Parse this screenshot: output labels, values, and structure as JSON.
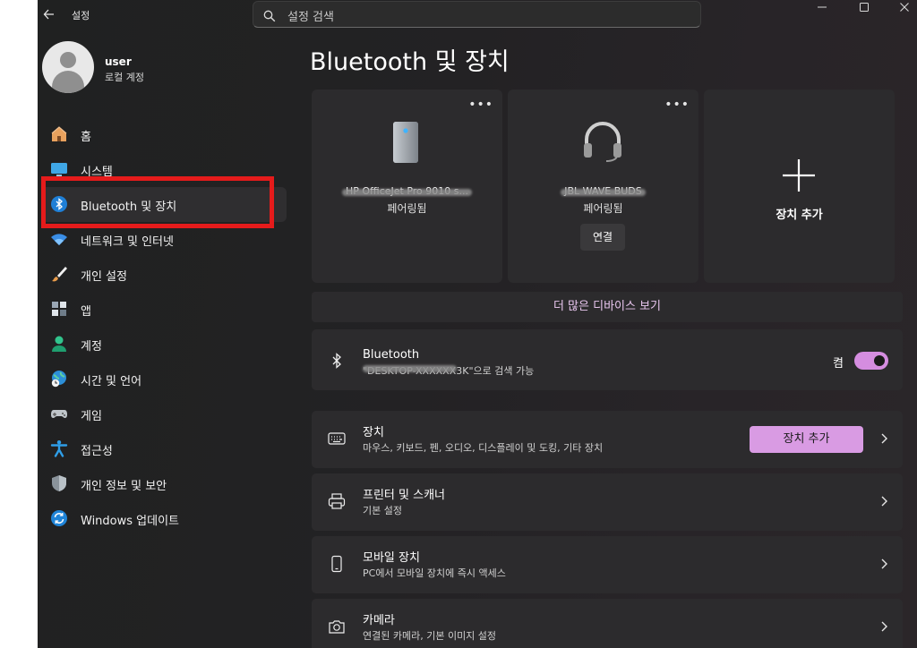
{
  "window": {
    "title": "설정",
    "search_placeholder": "설정 검색"
  },
  "profile": {
    "name": "user",
    "account_type": "로컬 계정"
  },
  "sidebar": {
    "items": [
      {
        "label": "홈",
        "icon": "home-icon"
      },
      {
        "label": "시스템",
        "icon": "monitor-icon"
      },
      {
        "label": "Bluetooth 및 장치",
        "icon": "bluetooth-icon",
        "active": true
      },
      {
        "label": "네트워크 및 인터넷",
        "icon": "wifi-icon"
      },
      {
        "label": "개인 설정",
        "icon": "brush-icon"
      },
      {
        "label": "앱",
        "icon": "apps-icon"
      },
      {
        "label": "계정",
        "icon": "account-icon"
      },
      {
        "label": "시간 및 언어",
        "icon": "globe-clock-icon"
      },
      {
        "label": "게임",
        "icon": "gamepad-icon"
      },
      {
        "label": "접근성",
        "icon": "accessibility-icon"
      },
      {
        "label": "개인 정보 및 보안",
        "icon": "shield-icon"
      },
      {
        "label": "Windows 업데이트",
        "icon": "update-icon"
      }
    ]
  },
  "main": {
    "title": "Bluetooth 및 장치",
    "devices": [
      {
        "name": "HP OfficeJet Pro 9010 s...",
        "status": "페어링됨",
        "icon": "printer-tower-icon"
      },
      {
        "name": "JBL WAVE BUDS",
        "status": "페어링됨",
        "icon": "headset-icon",
        "action": "연결"
      }
    ],
    "add_device_label": "장치 추가",
    "more_devices_label": "더 많은 디바이스 보기",
    "bluetooth": {
      "title": "Bluetooth",
      "subtitle": "\"DESKTOP-XXXXXX3K\"으로 검색 가능",
      "state_label": "켬"
    },
    "rows": [
      {
        "title": "장치",
        "subtitle": "마우스, 키보드, 펜, 오디오, 디스플레이 및 도킹, 기타 장치",
        "button": "장치 추가",
        "icon": "keyboard-device-icon"
      },
      {
        "title": "프린터 및 스캐너",
        "subtitle": "기본 설정",
        "icon": "printer-icon"
      },
      {
        "title": "모바일 장치",
        "subtitle": "PC에서 모바일 장치에 즉시 액세스",
        "icon": "phone-icon"
      },
      {
        "title": "카메라",
        "subtitle": "연결된 카메라, 기본 이미지 설정",
        "icon": "camera-icon"
      }
    ]
  },
  "colors": {
    "accent": "#d58de0",
    "annotation": "#e51b1b"
  }
}
